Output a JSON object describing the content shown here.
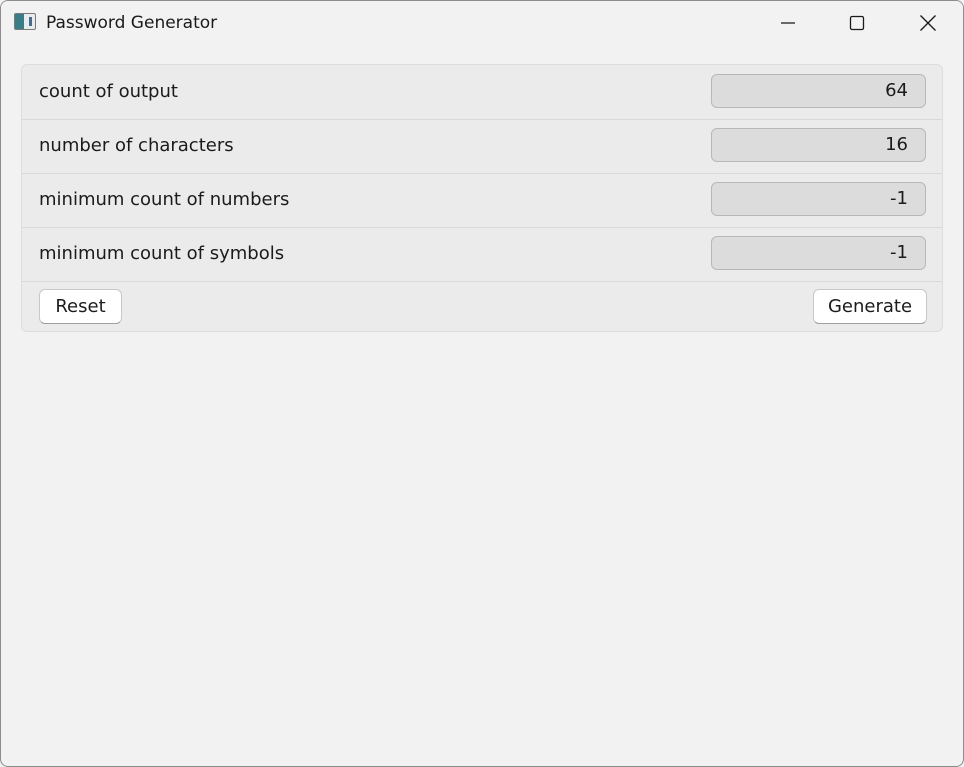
{
  "window": {
    "title": "Password Generator"
  },
  "fields": [
    {
      "label": "count of output",
      "value": "64"
    },
    {
      "label": "number of characters",
      "value": "16"
    },
    {
      "label": "minimum count of numbers",
      "value": "-1"
    },
    {
      "label": "minimum count of symbols",
      "value": "-1"
    }
  ],
  "buttons": {
    "reset_label": "Reset",
    "generate_label": "Generate"
  },
  "icons": {
    "app": "app-icon",
    "minimize": "minimize-icon",
    "maximize": "maximize-icon",
    "close": "close-icon"
  }
}
